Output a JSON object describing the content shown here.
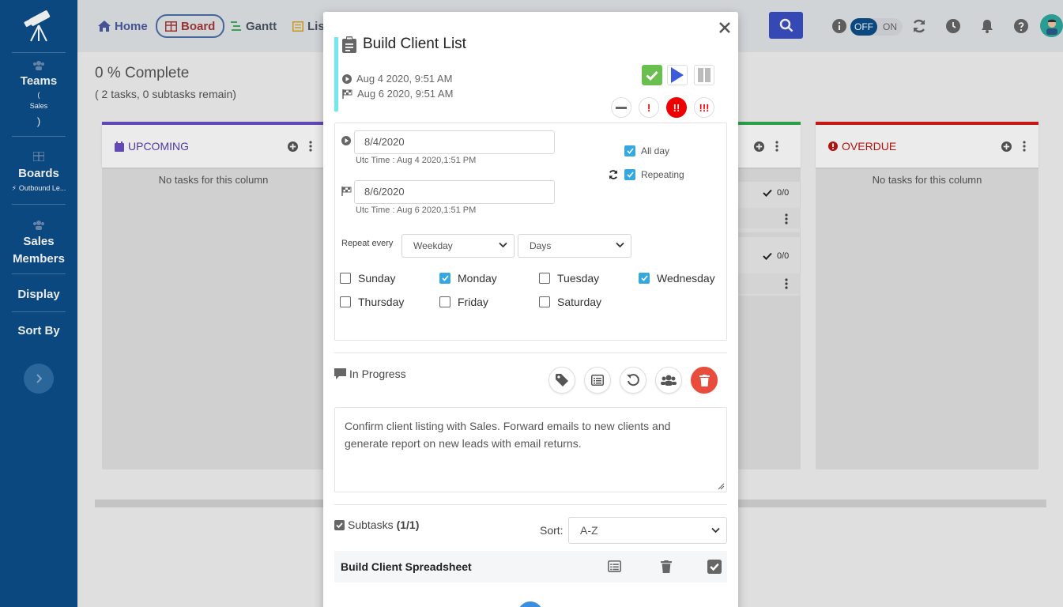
{
  "sidebar": {
    "teams": {
      "title": "Teams",
      "open_paren": "(",
      "subtitle": "Sales",
      "close_paren": ")"
    },
    "boards": {
      "title": "Boards",
      "subtitle": "Outbound Le..."
    },
    "members": {
      "line1": "Sales",
      "line2": "Members"
    },
    "display": "Display",
    "sort_by": "Sort By"
  },
  "nav": {
    "home": "Home",
    "board": "Board",
    "gantt": "Gantt",
    "list": "Lis"
  },
  "toggle": {
    "off": "OFF",
    "on": "ON"
  },
  "main": {
    "progress_title": "0 % Complete",
    "progress_sub": "( 2 tasks, 0 subtasks remain)",
    "columns": [
      {
        "title": "UPCOMING",
        "empty": "No tasks for this column",
        "color": "#6a4fc4"
      },
      {
        "title": "OVERDUE",
        "empty": "No tasks for this column",
        "color": "#d81b1b"
      }
    ],
    "mini_cards": [
      {
        "count": "0/0"
      },
      {
        "count": "0/0"
      }
    ]
  },
  "modal": {
    "title": "Build Client List",
    "start": "Aug 4 2020, 9:51 AM",
    "end": "Aug 6 2020, 9:51 AM",
    "start_date": "8/4/2020",
    "start_utc": "Utc Time : Aug 4 2020,1:51 PM",
    "end_date": "8/6/2020",
    "end_utc": "Utc Time : Aug 6 2020,1:51 PM",
    "all_day": "All day",
    "repeating": "Repeating",
    "repeat_every": "Repeat every",
    "repeat_type": "Weekday",
    "repeat_unit": "Days",
    "days": [
      {
        "name": "Sunday",
        "checked": false
      },
      {
        "name": "Monday",
        "checked": true
      },
      {
        "name": "Tuesday",
        "checked": false
      },
      {
        "name": "Wednesday",
        "checked": true
      },
      {
        "name": "Thursday",
        "checked": false
      },
      {
        "name": "Friday",
        "checked": false
      },
      {
        "name": "Saturday",
        "checked": false
      }
    ],
    "priorities": [
      "!",
      "!!",
      "!!!"
    ],
    "status": "In Progress",
    "description": "Confirm client listing with Sales. Forward emails to new clients and generate report on new leads with email returns.",
    "subtasks_label": "Subtasks",
    "subtasks_count": "(1/1)",
    "sort_label": "Sort:",
    "sort_value": "A-Z",
    "subtasks": [
      {
        "name": "Build Client Spreadsheet"
      }
    ]
  },
  "colors": {
    "sidebar": "#0b4f8a",
    "accent_bar": "#6fe8ee",
    "complete_green": "#6bbf4e",
    "play_blue": "#3b5bdb",
    "delete_red": "#e74c3c",
    "checkbox_blue": "#35a8e0"
  }
}
